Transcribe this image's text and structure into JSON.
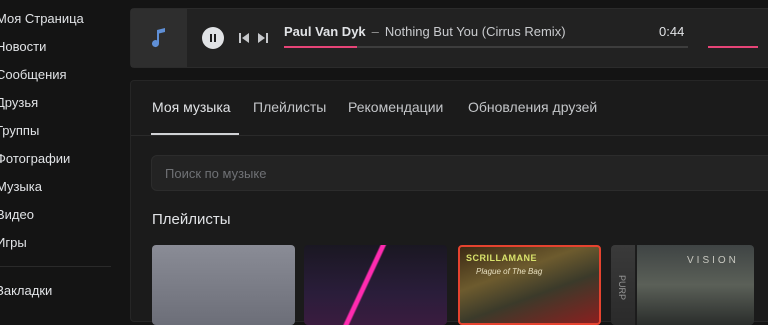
{
  "sidebar": {
    "items": [
      {
        "label": "Моя Страница"
      },
      {
        "label": "Новости"
      },
      {
        "label": "Сообщения"
      },
      {
        "label": "Друзья"
      },
      {
        "label": "Группы"
      },
      {
        "label": "Фотографии"
      },
      {
        "label": "Музыка"
      },
      {
        "label": "Видео"
      },
      {
        "label": "Игры"
      },
      {
        "label": "Закладки"
      }
    ]
  },
  "player": {
    "cover_icon": "music-note-icon",
    "artist": "Paul Van Dyk",
    "separator": "–",
    "title": "Nothing But You (Cirrus Remix)",
    "time": "0:44",
    "progress_fraction": 0.18,
    "volume_fraction": 1.0,
    "accent_color": "#e64477"
  },
  "tabs": [
    {
      "label": "Моя музыка",
      "active": true
    },
    {
      "label": "Плейлисты"
    },
    {
      "label": "Рекомендации"
    },
    {
      "label": "Обновления друзей"
    }
  ],
  "search": {
    "placeholder": "Поиск по музыке"
  },
  "playlists_section": {
    "title": "Плейлисты",
    "covers": [
      {
        "art_text": ""
      },
      {
        "art_text": ""
      },
      {
        "art_text": "SCRILLAMANE",
        "art_sub": "Plague of The Bag"
      },
      {
        "art_text": "VISION",
        "side_text": "PURP"
      },
      {
        "art_text": ""
      }
    ]
  }
}
